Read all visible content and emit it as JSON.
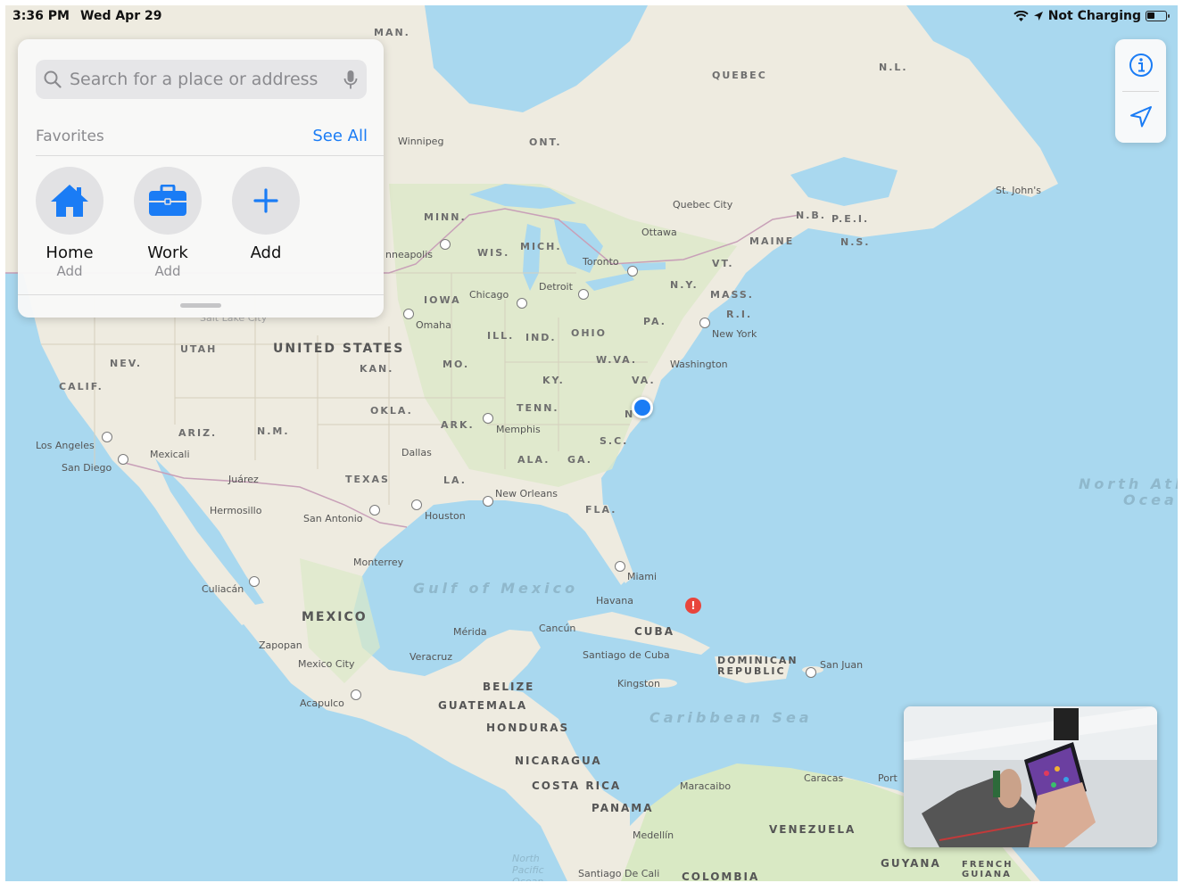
{
  "status_bar": {
    "time": "3:36 PM",
    "date": "Wed Apr 29",
    "charging": "Not Charging"
  },
  "search": {
    "placeholder": "Search for a place or address"
  },
  "favorites": {
    "title": "Favorites",
    "see_all": "See All",
    "items": [
      {
        "label": "Home",
        "sub": "Add",
        "icon": "house-icon"
      },
      {
        "label": "Work",
        "sub": "Add",
        "icon": "briefcase-icon"
      },
      {
        "label": "Add",
        "sub": "",
        "icon": "plus-icon"
      }
    ]
  },
  "controls": {
    "info_icon": "info-icon",
    "locate_icon": "location-arrow-icon"
  },
  "map": {
    "countries": {
      "usa": "UNITED STATES",
      "mexico": "MEXICO",
      "cuba": "CUBA",
      "dominican_republic": "DOMINICAN REPUBLIC",
      "guatemala": "GUATEMALA",
      "belize": "BELIZE",
      "honduras": "HONDURAS",
      "nicaragua": "NICARAGUA",
      "costa_rica": "COSTA RICA",
      "panama": "PANAMA",
      "venezuela": "VENEZUELA",
      "colombia": "COLOMBIA",
      "guyana": "GUYANA",
      "french_guiana": "FRENCH GUIANA"
    },
    "regions": {
      "quebec": "QUEBEC",
      "ont": "ONT.",
      "man": "MAN.",
      "nl": "N.L.",
      "nb": "N.B.",
      "pei": "P.E.I.",
      "ns": "N.S.",
      "maine": "MAINE",
      "vt": "VT.",
      "mass": "MASS.",
      "ri": "R.I.",
      "ny": "N.Y.",
      "pa": "PA.",
      "minn": "MINN.",
      "wis": "WIS.",
      "mich": "MICH.",
      "iowa": "IOWA",
      "ill": "ILL.",
      "ind": "IND.",
      "ohio": "OHIO",
      "wva": "W.VA.",
      "va": "VA.",
      "ky": "KY.",
      "tenn": "TENN.",
      "nc": "N",
      "sc": "S.C.",
      "ga": "GA.",
      "ala": "ALA.",
      "fla": "FLA.",
      "la": "LA.",
      "ark": "ARK.",
      "okla": "OKLA.",
      "texas": "TEXAS",
      "kan": "KAN.",
      "mo": "MO.",
      "nm": "N.M.",
      "ariz": "ARIZ.",
      "utah": "UTAH",
      "nev": "NEV.",
      "calif": "CALIF."
    },
    "cities": {
      "winnipeg": "Winnipeg",
      "quebec_city": "Quebec City",
      "st_johns": "St. John's",
      "ottawa": "Ottawa",
      "toronto": "Toronto",
      "detroit": "Detroit",
      "chicago": "Chicago",
      "minneapolis": "nneapolis",
      "omaha": "Omaha",
      "new_york": "New York",
      "washington": "Washington",
      "memphis": "Memphis",
      "dallas": "Dallas",
      "new_orleans": "New Orleans",
      "houston": "Houston",
      "san_antonio": "San Antonio",
      "miami": "Miami",
      "havana": "Havana",
      "los_angeles": "Los Angeles",
      "san_diego": "San Diego",
      "mexicali": "Mexicali",
      "juarez": "Juárez",
      "hermosillo": "Hermosillo",
      "monterrey": "Monterrey",
      "culiacan": "Culiacán",
      "zapopan": "Zapopan",
      "mexico_city": "Mexico City",
      "acapulco": "Acapulco",
      "merida": "Mérida",
      "cancun": "Cancún",
      "veracruz": "Veracruz",
      "santiago_de_cuba": "Santiago de Cuba",
      "kingston": "Kingston",
      "san_juan": "San Juan",
      "caracas": "Caracas",
      "port": "Port",
      "maracaibo": "Maracaibo",
      "medellin": "Medellín",
      "santiago_de_cali": "Santiago De Cali",
      "salt_lake_city": "Salt Lake City"
    },
    "seas": {
      "gulf_of_mexico": "Gulf of Mexico",
      "caribbean": "Caribbean Sea",
      "north_atlantic": "North Atl",
      "north_atlantic_2": "Ocea",
      "north_pacific": "North Pacific Ocean"
    }
  },
  "colors": {
    "water": "#a9d8ef",
    "land": "#f1ede2",
    "forest": "#d9e9c4",
    "accent": "#1a7cf5"
  }
}
